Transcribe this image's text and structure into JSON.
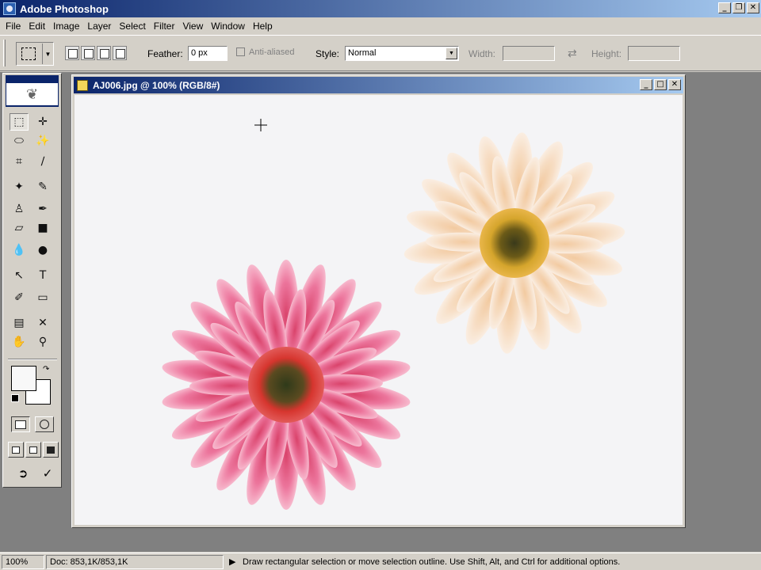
{
  "app": {
    "title": "Adobe Photoshop",
    "window_buttons": [
      "_",
      "❐",
      "✕"
    ]
  },
  "menu": [
    "File",
    "Edit",
    "Image",
    "Layer",
    "Select",
    "Filter",
    "View",
    "Window",
    "Help"
  ],
  "options": {
    "feather_label": "Feather:",
    "feather_value": "0 px",
    "antialiased_label": "Anti-aliased",
    "style_label": "Style:",
    "style_value": "Normal",
    "width_label": "Width:",
    "height_label": "Height:"
  },
  "toolbox": {
    "tools": [
      {
        "name": "rectangular-marquee-tool",
        "glyph": "⬚",
        "active": true
      },
      {
        "name": "move-tool",
        "glyph": "✛"
      },
      {
        "name": "lasso-tool",
        "glyph": "⬭"
      },
      {
        "name": "magic-wand-tool",
        "glyph": "✨"
      },
      {
        "name": "crop-tool",
        "glyph": "⌗"
      },
      {
        "name": "slice-tool",
        "glyph": "∕"
      },
      {
        "name": "healing-brush-tool",
        "glyph": "✦"
      },
      {
        "name": "brush-tool",
        "glyph": "✎"
      },
      {
        "name": "clone-stamp-tool",
        "glyph": "♙"
      },
      {
        "name": "history-brush-tool",
        "glyph": "✒"
      },
      {
        "name": "eraser-tool",
        "glyph": "▱"
      },
      {
        "name": "gradient-tool",
        "glyph": "■"
      },
      {
        "name": "blur-tool",
        "glyph": "💧"
      },
      {
        "name": "dodge-tool",
        "glyph": "●"
      },
      {
        "name": "path-selection-tool",
        "glyph": "↖"
      },
      {
        "name": "type-tool",
        "glyph": "T"
      },
      {
        "name": "pen-tool",
        "glyph": "✐"
      },
      {
        "name": "rectangle-tool",
        "glyph": "▭"
      },
      {
        "name": "notes-tool",
        "glyph": "▤"
      },
      {
        "name": "eyedropper-tool",
        "glyph": "✕"
      },
      {
        "name": "hand-tool",
        "glyph": "✋"
      },
      {
        "name": "zoom-tool",
        "glyph": "⚲"
      }
    ]
  },
  "document": {
    "title": "AJ006.jpg @ 100% (RGB/8#)"
  },
  "status": {
    "zoom": "100%",
    "doc_size": "Doc: 853,1K/853,1K",
    "hint": "Draw rectangular selection or move selection outline.  Use Shift, Alt, and Ctrl for additional options."
  },
  "colors": {
    "titlebar_start": "#0a246a",
    "titlebar_end": "#a6caf0",
    "pink_flower": "#e8588a",
    "cream_flower": "#f7dfc4",
    "flower_center": "#c7a02a"
  }
}
